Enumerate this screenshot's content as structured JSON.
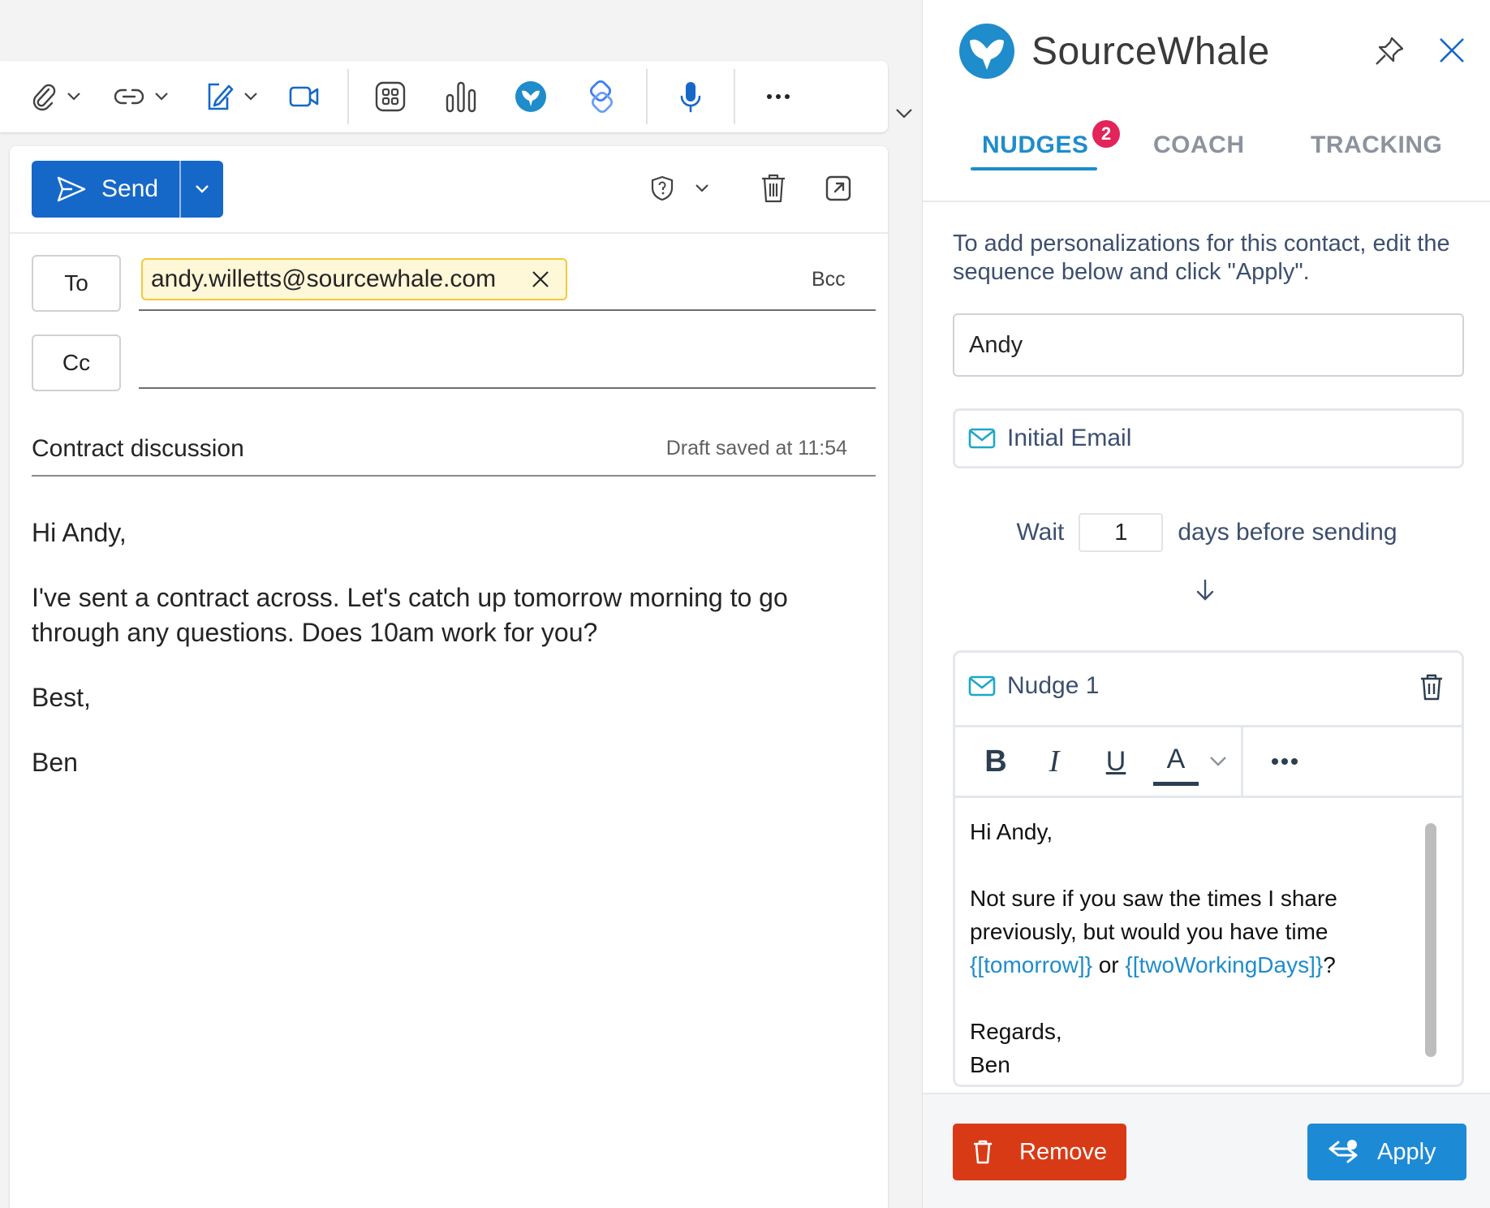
{
  "colors": {
    "outlook_blue": "#1568c7",
    "sourcewhale_blue": "#1f8ccb",
    "badge_red": "#e2245a",
    "remove_red": "#d93a16",
    "apply_blue": "#1d8ad6",
    "recipient_chip_bg": "#fef7d8"
  },
  "toolbar": {
    "icons": [
      "paperclip-icon",
      "link-icon",
      "signature-icon",
      "video-icon",
      "apps-icon",
      "chart-icon",
      "sourcewhale-icon",
      "viva-icon",
      "microphone-icon",
      "more-icon"
    ]
  },
  "compose": {
    "send_label": "Send",
    "to_label": "To",
    "cc_label": "Cc",
    "bcc_label": "Bcc",
    "recipient": "andy.willetts@sourcewhale.com",
    "cc_value": "",
    "subject": "Contract discussion",
    "draft_status": "Draft saved at 11:54",
    "body": {
      "greeting": "Hi Andy,",
      "paragraph": "I've sent a contract across. Let's catch up tomorrow morning to go through any questions. Does 10am work for you?",
      "signoff": "Best,",
      "signature": "Ben"
    }
  },
  "panel": {
    "title": "SourceWhale",
    "tabs": [
      {
        "label": "NUDGES",
        "active": true,
        "badge": "2"
      },
      {
        "label": "COACH",
        "active": false
      },
      {
        "label": "TRACKING",
        "active": false
      }
    ],
    "instructions": "To add personalizations for this contact, edit the sequence below and click \"Apply\".",
    "name_value": "Andy",
    "initial_email_label": "Initial Email",
    "wait_prefix": "Wait",
    "wait_days": "1",
    "wait_suffix": "days before sending",
    "nudge": {
      "title": "Nudge 1",
      "editor_buttons": {
        "bold": "B",
        "italic": "I",
        "underline": "U",
        "font_color": "A"
      },
      "body": {
        "greeting": "Hi Andy,",
        "line_1": "Not sure if you saw the times I share previously, but would you have time ",
        "var_1": "{[tomorrow]}",
        "or": " or ",
        "var_2": "{[twoWorkingDays]}",
        "end": "?",
        "signoff": "Regards,",
        "signature": "Ben"
      }
    },
    "remove_label": "Remove",
    "apply_label": "Apply"
  }
}
